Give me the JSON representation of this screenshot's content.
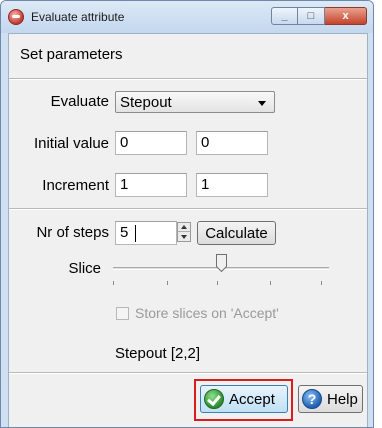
{
  "window": {
    "title": "Evaluate attribute",
    "close_glyph": "x",
    "minimize_glyph": "_",
    "maximize_glyph": "□"
  },
  "header": {
    "label": "Set parameters"
  },
  "evaluate": {
    "label": "Evaluate",
    "value": "Stepout"
  },
  "initial_value": {
    "label": "Initial value",
    "value1": "0",
    "value2": "0"
  },
  "increment": {
    "label": "Increment",
    "value1": "1",
    "value2": "1"
  },
  "steps": {
    "label": "Nr of steps",
    "value": "5",
    "calculate_label": "Calculate"
  },
  "slice": {
    "label": "Slice",
    "position": 0.5
  },
  "store_slices": {
    "label": "Store slices on 'Accept'",
    "checked": false,
    "enabled": false
  },
  "status": {
    "text": "Stepout [2,2]"
  },
  "buttons": {
    "accept_label": "Accept",
    "help_label": "Help",
    "help_glyph": "?"
  },
  "colors": {
    "highlight": "#d91c1c",
    "accent": "#3c7fb1"
  }
}
